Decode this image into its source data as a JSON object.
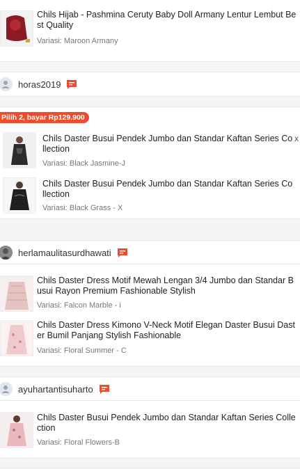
{
  "products": [
    {
      "title_l1": "Chils Hijab - Pashmina Ceruty Baby Doll Armany Lentur Lembut Be",
      "title_l2": "st Quality",
      "variant": "Variasi: Maroon Armany"
    },
    {
      "title_l1": "Chils Daster Busui Pendek Jumbo dan Standar Kaftan Series Co",
      "title_l2": "llection",
      "variant": "Variasi: Black Jasmine-J"
    },
    {
      "title_l1": "Chils Daster Busui Pendek Jumbo dan Standar Kaftan Series Co",
      "title_l2": "llection",
      "variant": "Variasi: Black Grass - X"
    },
    {
      "title_l1": "Chils Daster Dress Motif Mewah Lengan 3/4 Jumbo dan Standar B",
      "title_l2": "usui Rayon Premium Fashionable Stylish",
      "variant": "Variasi: Falcon Marble - i"
    },
    {
      "title_l1": "Chils Daster Dress Kimono V-Neck Motif Elegan Daster Busui Dast",
      "title_l2": "er Bumil Panjang Stylish Fashionable",
      "variant": "Variasi: Floral Summer - C"
    },
    {
      "title_l1": "Chils Daster Busui Pendek Jumbo dan Standar Kaftan Series Colle",
      "title_l2": "ction",
      "variant": "Variasi: Floral Flowers-B"
    }
  ],
  "users": [
    "horas2019",
    "herlamaulitasurdhawati",
    "ayuhartantisuharto"
  ],
  "promo_label": "Pilih 2, bayar Rp129.900",
  "remove_symbol": "x",
  "colors": {
    "accent": "#ee4d2d",
    "background": "#f5f5f5"
  }
}
